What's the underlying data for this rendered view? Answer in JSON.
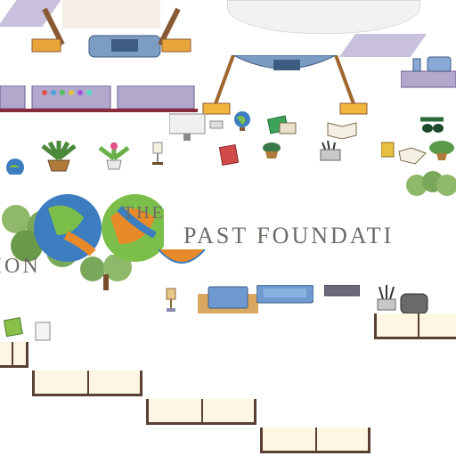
{
  "logo": {
    "word_the": "THE",
    "word_past_foundation": "PAST FOUNDATI",
    "word_ion": "ION"
  },
  "colors": {
    "lavender": "#c8c0dc",
    "wood": "#7a4b2a",
    "metal_blue": "#6f8fb8",
    "bush": "#8fb86a",
    "shelf_frame": "#5a4034",
    "shelf_fill": "#fdf6e3",
    "globe_blue": "#3b7dbf",
    "globe_green": "#7bbf4a",
    "globe_orange": "#e88a2a"
  },
  "icons": [
    "lander-icon",
    "globe-icon",
    "potted-plant-icon",
    "book-icon",
    "desk-lamp-icon",
    "computer-monitor-icon",
    "pencil-cup-icon",
    "sofa-icon",
    "armchair-icon",
    "tree-icon"
  ]
}
